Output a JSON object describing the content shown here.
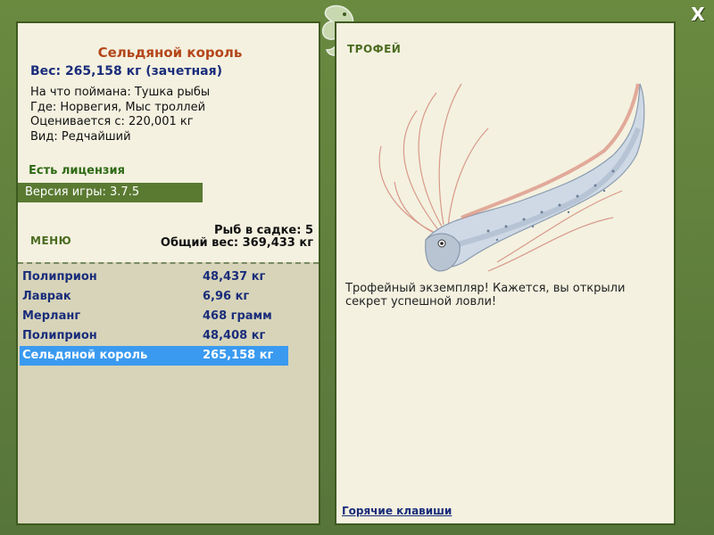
{
  "window": {
    "close_label": "X"
  },
  "fish_info": {
    "title": "Сельдяной король",
    "weight_line": "Вес: 265,158 кг (зачетная)",
    "caught_on": "На что поймана: Тушка рыбы",
    "location": "Где: Норвегия, Мыс троллей",
    "valued_from": "Оценивается с: 220,001 кг",
    "kind": "Вид: Редчайший"
  },
  "license": {
    "label": "Есть лицензия"
  },
  "version": {
    "label": "Версия игры: 3.7.5"
  },
  "menu": {
    "label": "МЕНЮ"
  },
  "cage": {
    "count_line": "Рыб в садке: 5",
    "total_line": "Общий вес: 369,433 кг"
  },
  "catch_list": [
    {
      "name": "Полиприон",
      "weight": "48,437 кг",
      "selected": false
    },
    {
      "name": "Лаврак",
      "weight": "6,96 кг",
      "selected": false
    },
    {
      "name": "Мерланг",
      "weight": "468 грамм",
      "selected": false
    },
    {
      "name": "Полиприон",
      "weight": "48,408 кг",
      "selected": false
    },
    {
      "name": "Сельдяной король",
      "weight": "265,158 кг",
      "selected": true
    }
  ],
  "trophy": {
    "label": "ТРОФЕЙ",
    "message": "Трофейный экземпляр! Кажется, вы открыли секрет успешной ловли!"
  },
  "footer": {
    "hotkeys_label": "Горячие клавиши"
  },
  "colors": {
    "frame_green": "#5b7a36",
    "panel_bg": "#f4f1e0",
    "list_bg": "#d7d4b9",
    "title_orange": "#b4471a",
    "text_blue": "#1a2d7a",
    "selection_blue": "#3a9af0"
  }
}
